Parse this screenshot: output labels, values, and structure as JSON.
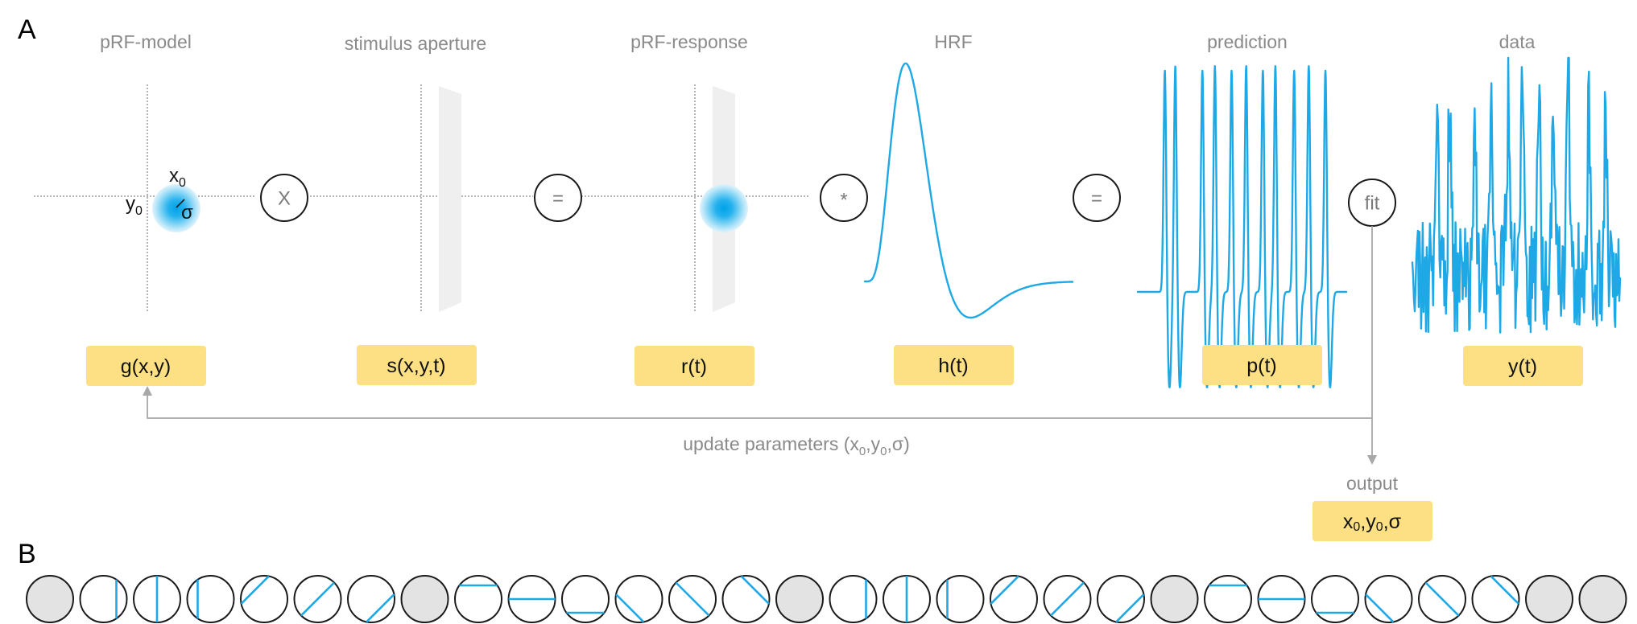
{
  "panel_a_letter": "A",
  "panel_b_letter": "B",
  "stages": [
    {
      "title": "pRF-model",
      "label": "g(x,y)"
    },
    {
      "title": "stimulus aperture",
      "label": "s(x,y,t)"
    },
    {
      "title": "pRF-response",
      "label": "r(t)"
    },
    {
      "title": "HRF",
      "label": "h(t)"
    },
    {
      "title": "prediction",
      "label": "p(t)"
    },
    {
      "title": "data",
      "label": "y(t)"
    }
  ],
  "operators": [
    "X",
    "=",
    "*",
    "=",
    "fit"
  ],
  "params": {
    "x": "x",
    "y": "y",
    "sub": "0",
    "sigma": "σ"
  },
  "loop": {
    "prefix": "update parameters (",
    "x": "x",
    "y": "y",
    "sub": "0",
    "sep": ",",
    "sigma": "σ",
    "suffix": ")"
  },
  "output": {
    "title": "output",
    "x": "x",
    "y": "y",
    "sub": "0",
    "sep": ",",
    "sigma": "σ"
  },
  "colors": {
    "signal": "#1ea9e6",
    "label_box": "#fde083",
    "aperture": "#efefef",
    "blank_frame": "#e3e3e3"
  },
  "stimulus_frames": [
    "blank",
    "bar-vertical",
    "bar-vertical",
    "bar-vertical",
    "bar-diagonal-up",
    "bar-diagonal-up",
    "bar-diagonal-up",
    "blank",
    "bar-horizontal",
    "bar-horizontal",
    "bar-horizontal",
    "bar-diagonal-down",
    "bar-diagonal-down",
    "bar-diagonal-down",
    "blank",
    "bar-vertical",
    "bar-vertical",
    "bar-vertical",
    "bar-diagonal-up",
    "bar-diagonal-up",
    "bar-diagonal-up",
    "blank",
    "bar-horizontal",
    "bar-horizontal",
    "bar-horizontal",
    "bar-diagonal-down",
    "bar-diagonal-down",
    "bar-diagonal-down",
    "blank",
    "blank"
  ]
}
